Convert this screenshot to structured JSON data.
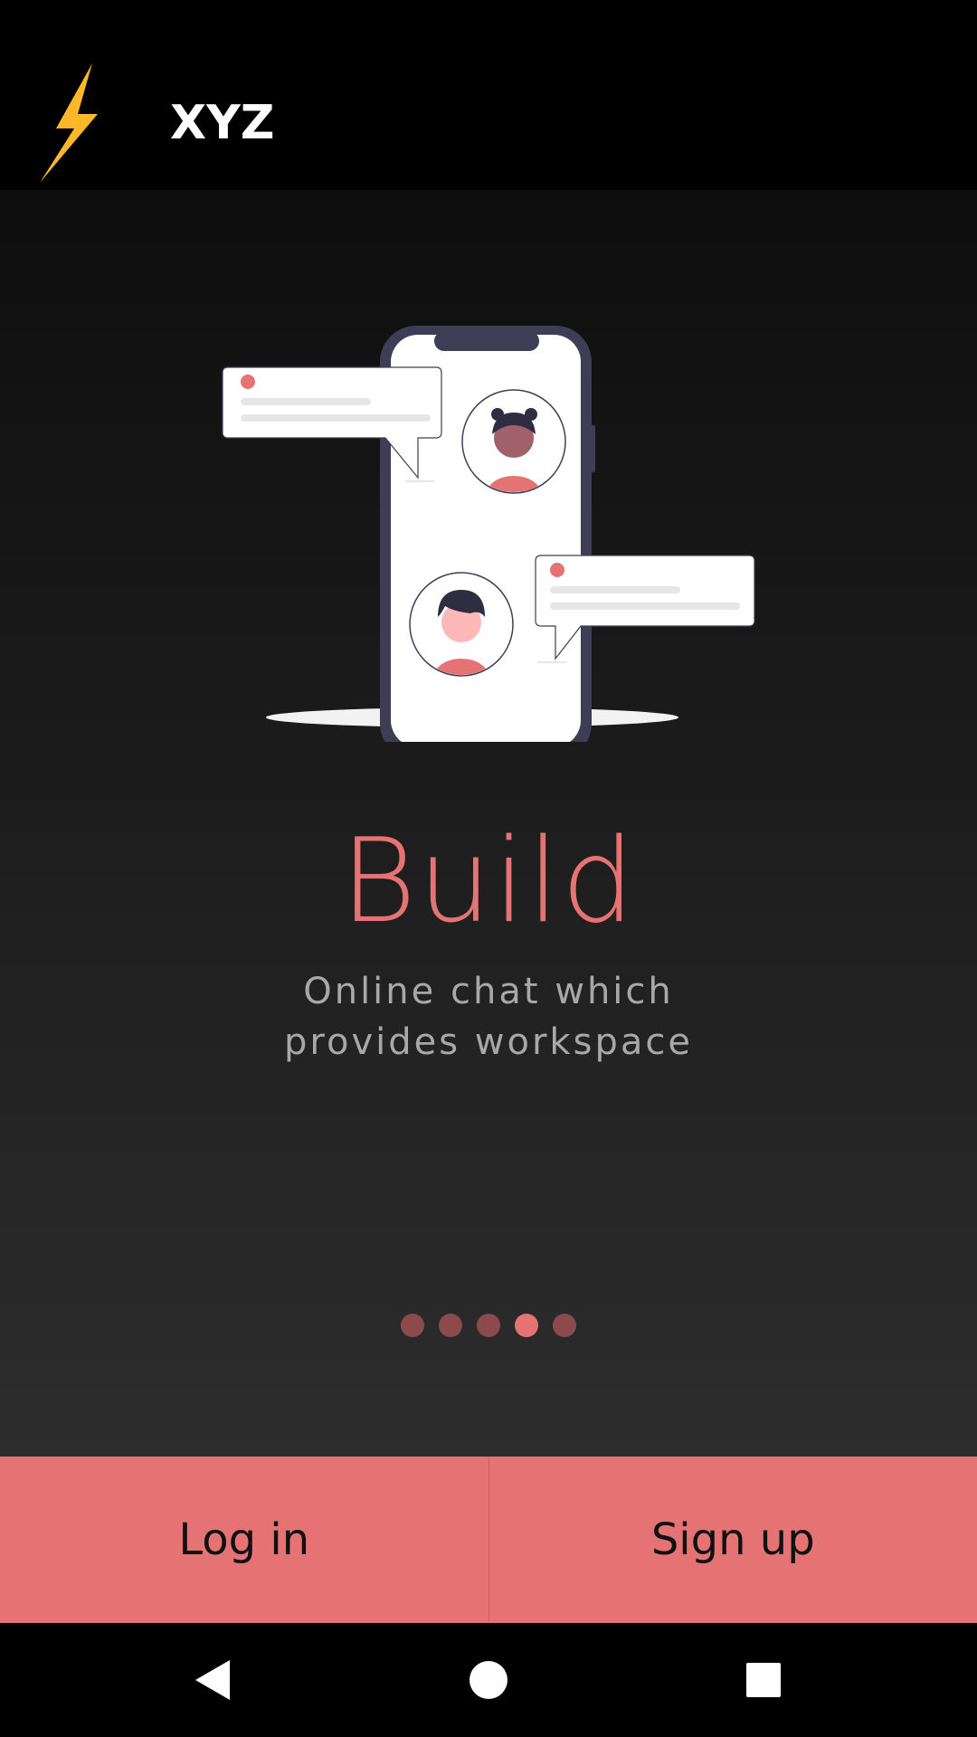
{
  "app_bar": {
    "title": "XYZ",
    "logo_icon": "lightning-bolt-icon",
    "logo_color": "#fbb829"
  },
  "onboarding": {
    "illustration": "phone-chat-illustration",
    "title": "Build",
    "subtitle": "Online chat which provides workspace",
    "pager": {
      "total": 5,
      "active_index": 3
    }
  },
  "actions": {
    "login_label": "Log in",
    "signup_label": "Sign up"
  },
  "nav_bar": {
    "back_icon": "back-triangle-icon",
    "home_icon": "home-circle-icon",
    "recents_icon": "recents-square-icon"
  },
  "colors": {
    "accent": "#e57373",
    "dot_inactive": "#8b4a4c",
    "subtitle": "#a8a8a8",
    "phone_frame": "#3f3d56"
  }
}
